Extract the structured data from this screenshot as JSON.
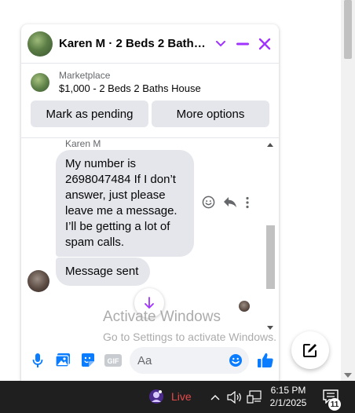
{
  "chat": {
    "title": "Karen M · 2 Beds 2 Baths House",
    "listing": {
      "label": "Marketplace",
      "price_title": "$1,000 - 2 Beds 2 Baths House",
      "buttons": [
        "Mark as pending",
        "More options"
      ]
    },
    "messages": {
      "sender_name": "Karen M",
      "first": "My number is 2698047484 If I don’t answer, just please leave me a message. I’ll be getting a lot of spam calls.",
      "second": "Message sent"
    },
    "composer": {
      "placeholder": "Aa"
    },
    "accent_color": "#a033ff",
    "composer_icon_color": "#0a7cff"
  },
  "watermark": {
    "title": "Activate Windows",
    "subtitle": "Go to Settings to activate Windows."
  },
  "taskbar": {
    "live_label": "Live",
    "time": "6:15 PM",
    "date": "2/1/2025",
    "notification_count": "11"
  }
}
